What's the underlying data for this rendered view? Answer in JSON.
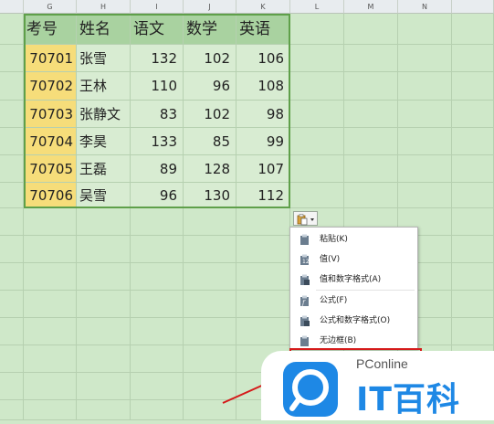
{
  "columns": [
    "G",
    "H",
    "I",
    "J",
    "K",
    "L",
    "M",
    "N"
  ],
  "table": {
    "headers": [
      "考号",
      "姓名",
      "语文",
      "数学",
      "英语"
    ],
    "rows": [
      [
        "70701",
        "张雪",
        "132",
        "102",
        "106"
      ],
      [
        "70702",
        "王林",
        "110",
        "96",
        "108"
      ],
      [
        "70703",
        "张静文",
        "83",
        "102",
        "98"
      ],
      [
        "70704",
        "李昊",
        "133",
        "85",
        "99"
      ],
      [
        "70705",
        "王磊",
        "89",
        "128",
        "107"
      ],
      [
        "70706",
        "吴雪",
        "96",
        "130",
        "112"
      ]
    ]
  },
  "paste_menu": {
    "trigger_icon": "paste-options-icon",
    "items": [
      {
        "label": "粘贴(K)",
        "icon": "paste-icon"
      },
      {
        "label": "值(V)",
        "icon": "paste-values-icon"
      },
      {
        "label": "值和数字格式(A)",
        "icon": "paste-values-number-format-icon"
      },
      {
        "label": "公式(F)",
        "icon": "paste-formula-icon"
      },
      {
        "label": "公式和数字格式(O)",
        "icon": "paste-formula-number-format-icon"
      },
      {
        "label": "无边框(B)",
        "icon": "paste-no-border-icon"
      }
    ]
  },
  "watermark": {
    "brand": "PConline",
    "logo_text": "IT百科"
  },
  "colors": {
    "sheet_bg": "#cfe8c9",
    "header_fill": "#a9d2a0",
    "id_fill": "#f6dd7a",
    "highlight": "#d51a1a",
    "watermark_blue": "#1e88e5"
  }
}
